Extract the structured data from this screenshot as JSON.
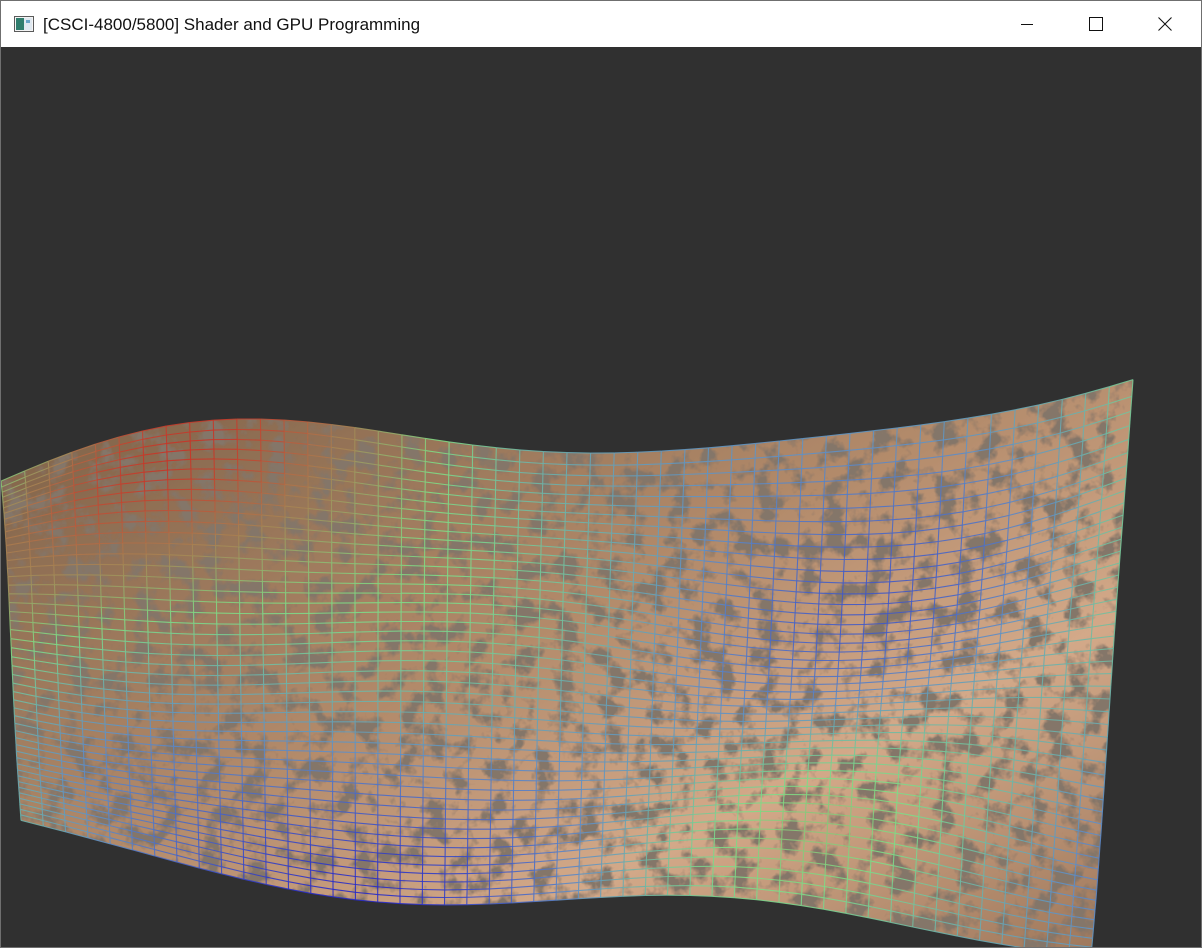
{
  "window": {
    "title": "[CSCI-4800/5800] Shader and GPU Programming",
    "icon": "app-window-icon",
    "controls": [
      "minimize-icon",
      "maximize-icon",
      "close-icon"
    ]
  },
  "scene": {
    "background_color": "#303030",
    "terrain_texture_colors": [
      "#c9a27e",
      "#8a6a4d",
      "#3b2e24",
      "#e0b89a"
    ],
    "wireframe_color_scale": {
      "low": "#2222c8",
      "mid_low": "#5f8fc6",
      "mid": "#7fdc86",
      "high": "#d61616"
    }
  }
}
